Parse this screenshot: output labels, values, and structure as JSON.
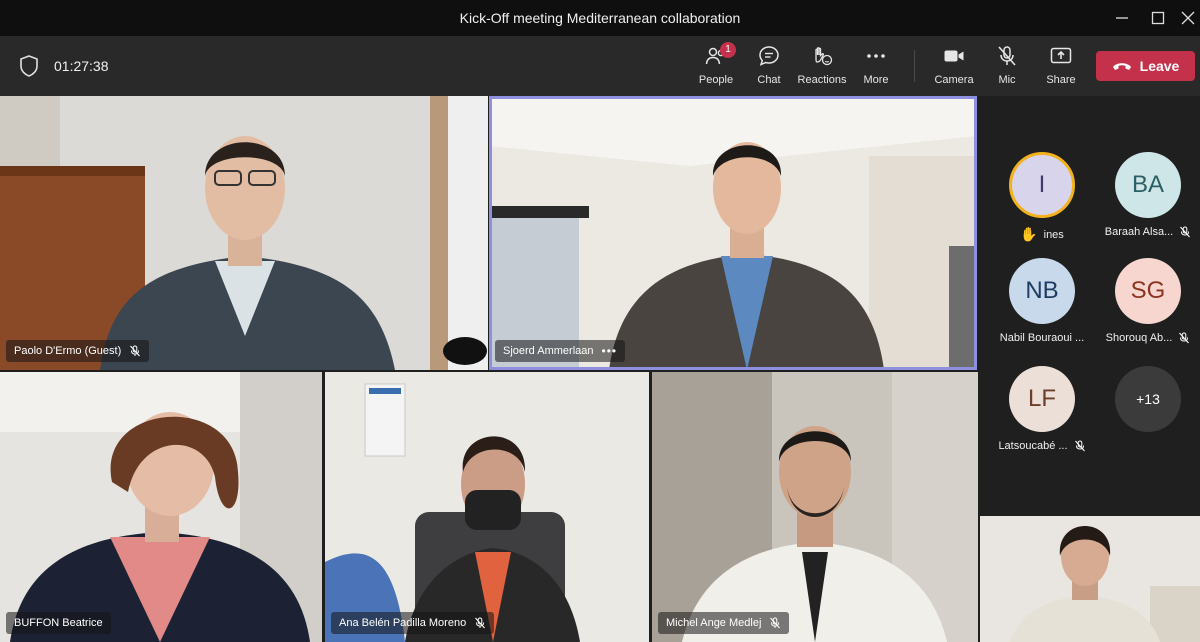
{
  "window": {
    "title": "Kick-Off meeting Mediterranean collaboration"
  },
  "toolbar": {
    "timer": "01:27:38",
    "people_label": "People",
    "people_badge": "1",
    "chat_label": "Chat",
    "reactions_label": "Reactions",
    "more_label": "More",
    "camera_label": "Camera",
    "mic_label": "Mic",
    "share_label": "Share",
    "leave_label": "Leave"
  },
  "participants": [
    {
      "name": "Paolo D'Ermo (Guest)",
      "muted": true
    },
    {
      "name": "Sjoerd Ammerlaan",
      "muted": false,
      "active_speaker": true
    },
    {
      "name": "BUFFON Beatrice",
      "muted": false
    },
    {
      "name": "Ana Belén Padilla Moreno",
      "muted": true
    },
    {
      "name": "Michel Ange Medlej",
      "muted": true
    }
  ],
  "roster": [
    {
      "initials": "I",
      "name": "ines",
      "hand_raised": true,
      "muted": false,
      "bg": "#d8d4ec",
      "fg": "#3d3a6b"
    },
    {
      "initials": "BA",
      "name": "Baraah Alsa...",
      "muted": true,
      "bg": "#cfe6e8",
      "fg": "#2c5f63"
    },
    {
      "initials": "NB",
      "name": "Nabil Bouraoui ...",
      "muted": false,
      "bg": "#c9d9ec",
      "fg": "#1f3d63"
    },
    {
      "initials": "SG",
      "name": "Shorouq Ab...",
      "muted": true,
      "bg": "#f6d6cf",
      "fg": "#8a3520"
    },
    {
      "initials": "LF",
      "name": "Latsoucabé ...",
      "muted": true,
      "bg": "#ecdfd8",
      "fg": "#6b3d2b"
    }
  ],
  "roster_overflow": "+13",
  "colors": {
    "leave": "#c4314b",
    "active_frame": "#8f8fe0",
    "hand": "#f2b21d"
  }
}
